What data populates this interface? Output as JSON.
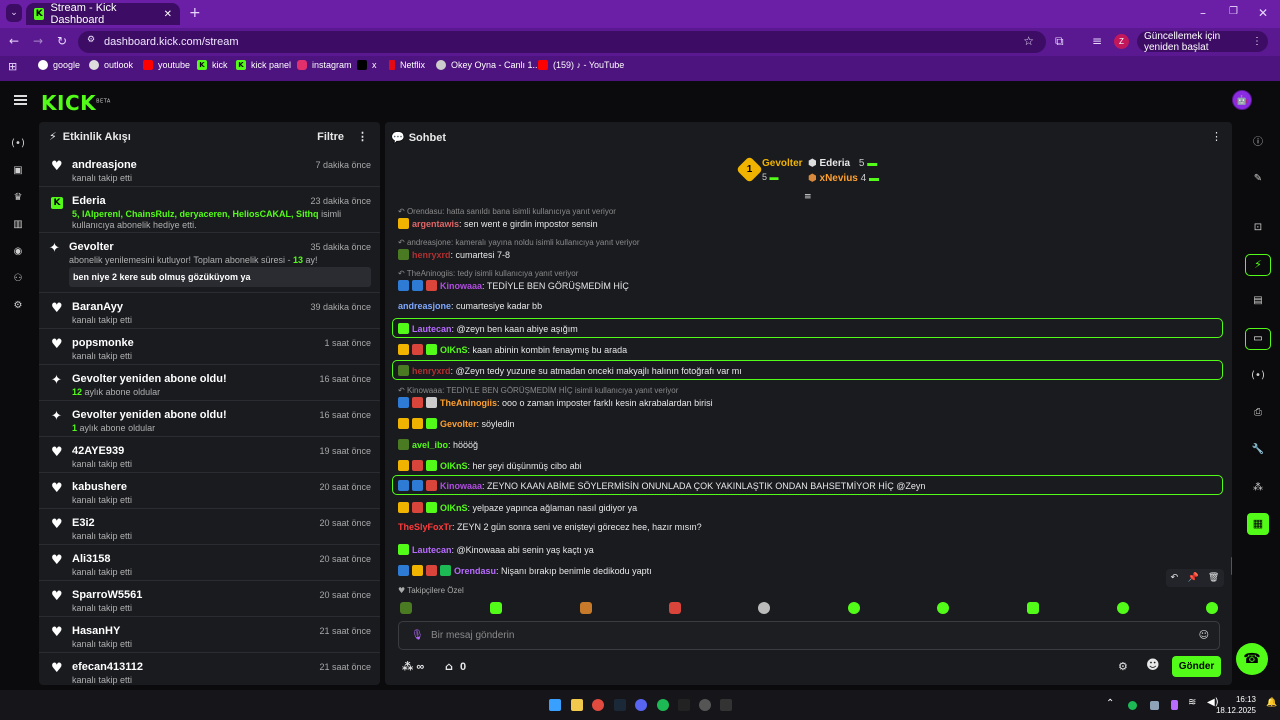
{
  "browser": {
    "tab_title": "Stream - Kick Dashboard",
    "url": "dashboard.kick.com/stream",
    "profile_initial": "Z",
    "update_button": "Güncellemek için yeniden başlat",
    "bookmarks": [
      "google",
      "outlook",
      "youtube",
      "kick",
      "kick panel",
      "instagram",
      "x",
      "Netflix",
      "Okey Oyna - Canlı 1...",
      "(159) ♪ - YouTube"
    ]
  },
  "kick": {
    "logo": "KICK",
    "logo_sup": "BETA"
  },
  "feed": {
    "title": "Etkinlik Akışı",
    "filter": "Filtre",
    "items": [
      {
        "icon": "heart-icon",
        "name": "andreasjone",
        "time": "7 dakika önce",
        "sub": "kanalı takip etti"
      },
      {
        "icon": "kick-gift-icon",
        "name": "Ederia",
        "time": "23 dakika önce",
        "sub_green": "5, lAlperenl, ChainsRulz, deryaceren, HeliosCAKAL, Sithq",
        "sub": "isimli kullanıcıya abonelik hediye etti."
      },
      {
        "icon": "star-icon",
        "name": "Gevolter",
        "time": "35 dakika önce",
        "sub": "abonelik yenilemesini kutluyor! Toplam abonelik süresi -",
        "sub_green": "13",
        "sub_end": "ay!",
        "message": "ben niye 2 kere sub olmuş gözüküyom ya"
      },
      {
        "icon": "heart-icon",
        "name": "BaranAyy",
        "time": "39 dakika önce",
        "sub": "kanalı takip etti"
      },
      {
        "icon": "heart-icon",
        "name": "popsmonke",
        "time": "1 saat önce",
        "sub": "kanalı takip etti"
      },
      {
        "icon": "star-icon",
        "name": "Gevolter yeniden abone oldu!",
        "time": "16 saat önce",
        "sub_green": "12",
        "sub": "aylık abone oldular"
      },
      {
        "icon": "star-icon",
        "name": "Gevolter yeniden abone oldu!",
        "time": "16 saat önce",
        "sub_green": "1",
        "sub": "aylık abone oldular"
      },
      {
        "icon": "heart-icon",
        "name": "42AYE939",
        "time": "19 saat önce",
        "sub": "kanalı takip etti"
      },
      {
        "icon": "heart-icon",
        "name": "kabushere",
        "time": "20 saat önce",
        "sub": "kanalı takip etti"
      },
      {
        "icon": "heart-icon",
        "name": "E3i2",
        "time": "20 saat önce",
        "sub": "kanalı takip etti"
      },
      {
        "icon": "heart-icon",
        "name": "Ali3158",
        "time": "20 saat önce",
        "sub": "kanalı takip etti"
      },
      {
        "icon": "heart-icon",
        "name": "SparroW5561",
        "time": "20 saat önce",
        "sub": "kanalı takip etti"
      },
      {
        "icon": "heart-icon",
        "name": "HasanHY",
        "time": "21 saat önce",
        "sub": "kanalı takip etti"
      },
      {
        "icon": "heart-icon",
        "name": "efecan413112",
        "time": "21 saat önce",
        "sub": "kanalı takip etti"
      }
    ]
  },
  "chat": {
    "title": "Sohbet",
    "leaderboard": {
      "first_name": "Gevolter",
      "first_count": "5",
      "first_rank": "1",
      "second_name": "Ederia",
      "second_count": "5",
      "third_name": "xNevius",
      "third_count": "4"
    },
    "messages": [
      {
        "reply": "Orendasu: hatta sanıldı bana isimli kullanıcıya yanıt veriyor"
      },
      {
        "user": "argentawis",
        "color": "#e06666",
        "text": ": sen went e girdin impostor sensin"
      },
      {
        "reply": "andreasjone: kameralı yayına noldu isimli kullanıcıya yanıt veriyor"
      },
      {
        "user": "henryxrd",
        "color": "#b23030",
        "text": ": cumartesi 7-8"
      },
      {
        "reply": "TheAninogiis: tedy isimli kullanıcıya yanıt veriyor"
      },
      {
        "user": "Kinowaaa",
        "color": "#b04ee0",
        "text": ": TEDİYLE BEN GÖRÜŞMEDİM HİÇ"
      },
      {
        "user": "andreasjone",
        "color": "#7fa8ff",
        "text": ": cumartesiye kadar bb"
      },
      {
        "user": "Lautecan",
        "color": "#b86bff",
        "text": ": @zeyn ben kaan abiye aşığım"
      },
      {
        "user": "OlKnS",
        "color": "#53fc18",
        "text": ": kaan abinin kombin fenaymış bu arada"
      },
      {
        "user": "henryxrd",
        "color": "#b23030",
        "text": ": @Zeyn tedy yuzune su atmadan onceki makyajlı halının fotoğrafı var mı"
      },
      {
        "reply": "Kinowaaa: TEDİYLE BEN GÖRÜŞMEDİM HİÇ isimli kullanıcıya yanıt veriyor"
      },
      {
        "user": "TheAninogiis",
        "color": "#ff9f2e",
        "text": ": ooo o zaman imposter farklı kesin akrabalardan birisi"
      },
      {
        "user": "Gevolter",
        "color": "#ff9f2e",
        "text": ": söyledin"
      },
      {
        "user": "avel_ibo",
        "color": "#53fc18",
        "text": ": höööğ"
      },
      {
        "user": "OlKnS",
        "color": "#53fc18",
        "text": ": her şeyi düşünmüş cibo abi"
      },
      {
        "user": "Kinowaaa",
        "color": "#b04ee0",
        "text": ": ZEYNO KAAN ABİME SÖYLERMİSİN ONUNLADA ÇOK YAKINLAŞTIK ONDAN BAHSETMİYOR HİÇ @Zeyn"
      },
      {
        "user": "OlKnS",
        "color": "#53fc18",
        "text": ": yelpaze yapınca ağlaman nasıl gidiyor ya"
      },
      {
        "user": "TheSlyFoxTr",
        "color": "#ff3b3b",
        "text": ": ZEYN 2 gün sonra seni ve enişteyi görecez hee, hazır mısın?"
      },
      {
        "user": "Lautecan",
        "color": "#b86bff",
        "text": ": @Kinowaaa abi senin yaş kaçtı ya"
      },
      {
        "user": "Orendasu",
        "color": "#b86bff",
        "text": ": Nişanı bırakıp benimle dedikodu yaptı"
      }
    ],
    "followers_only": "Takipçilere Özel",
    "placeholder": "Bir mesaj gönderin",
    "points": "∞",
    "store_count": "0",
    "send": "Gönder"
  },
  "taskbar": {
    "time": "16:13",
    "date": "18.12.2025"
  }
}
